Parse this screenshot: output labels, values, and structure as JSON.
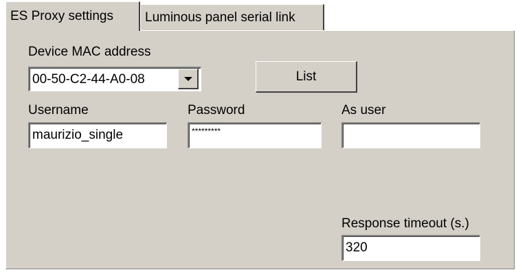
{
  "tabs": [
    {
      "label": "ES Proxy settings",
      "active": true
    },
    {
      "label": "Luminous panel serial link",
      "active": false
    }
  ],
  "device": {
    "label": "Device MAC address",
    "selected_value": "00-50-C2-44-A0-08",
    "dropdown_icon": "chevron-down-icon",
    "list_button_label": "List"
  },
  "credentials": {
    "username_label": "Username",
    "username_value": "maurizio_single",
    "password_label": "Password",
    "password_value": "*********",
    "as_user_label": "As user",
    "as_user_value": ""
  },
  "timeout": {
    "label": "Response timeout (s.)",
    "value": "320"
  },
  "colors": {
    "panel_background": "#d4d0c8",
    "field_background": "#ffffff"
  }
}
